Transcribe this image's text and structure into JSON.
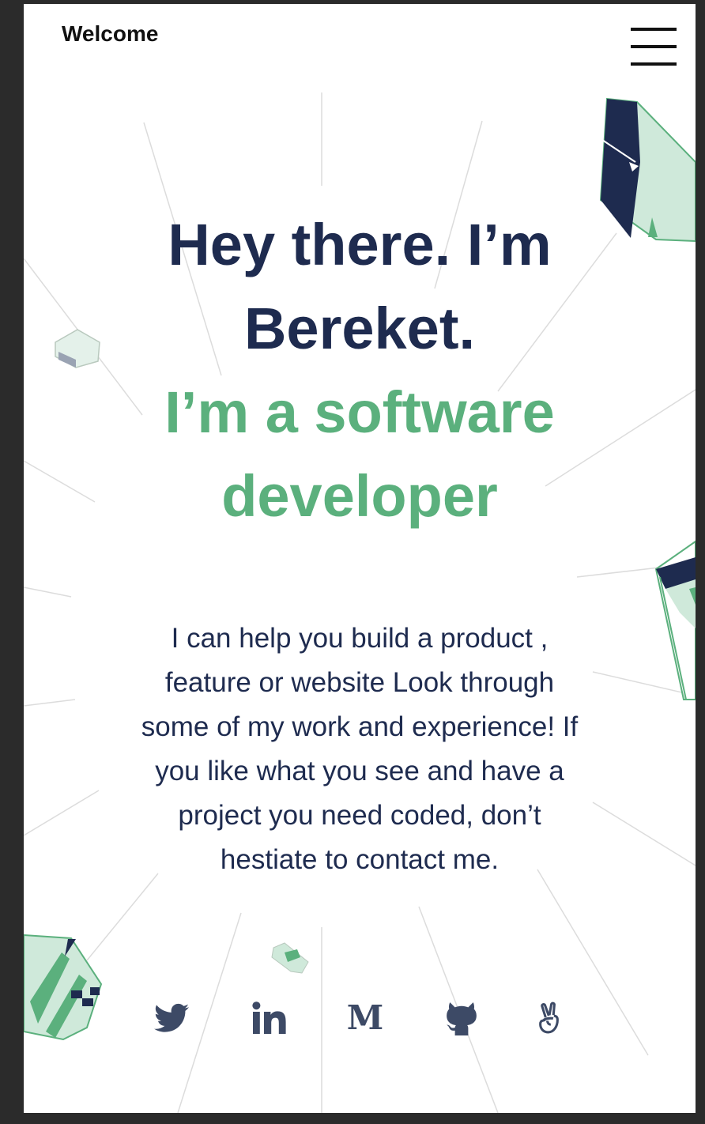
{
  "header": {
    "title": "Welcome",
    "menu_icon": "hamburger-menu-icon"
  },
  "hero": {
    "line1": "Hey there. I’m",
    "line2": "Bereket.",
    "line3": "I’m a software",
    "line4": "developer"
  },
  "intro": {
    "lines": [
      "I can help you build a product ,",
      "feature or website Look through",
      "some of my work and experience! If",
      "you like what you see and have a",
      "project you need coded, don’t",
      "hestiate to contact me."
    ]
  },
  "social": {
    "icons": [
      "twitter-icon",
      "linkedin-icon",
      "medium-icon",
      "github-icon",
      "angellist-icon"
    ],
    "medium_letter": "M"
  },
  "colors": {
    "navy": "#1e2b4f",
    "green": "#5bb07d",
    "mint": "#cfe9da",
    "frame": "#2b2b2b"
  }
}
